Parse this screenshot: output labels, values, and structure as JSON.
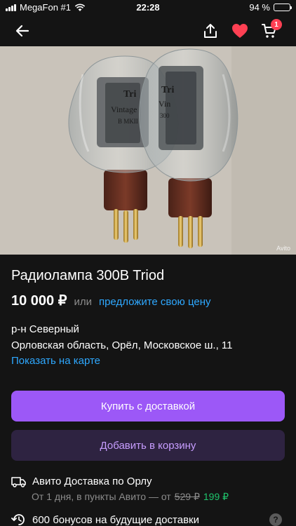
{
  "status": {
    "carrier": "MegaFon #1",
    "time": "22:28",
    "battery": "94 %",
    "battery_level": 0.94
  },
  "header": {
    "cart_count": "1",
    "icons": [
      "back-arrow-icon",
      "share-icon",
      "heart-icon",
      "cart-icon"
    ]
  },
  "photo": {
    "watermark": "Avito",
    "tube_left_label": [
      "Tri",
      "Vintage",
      "B MKII"
    ],
    "tube_right_label": [
      "Tri",
      "Vin",
      "300"
    ]
  },
  "listing": {
    "title": "Радиолампа 300B Triod",
    "price": "10 000 ₽",
    "price_or": "или",
    "price_offer": "предложите свою цену",
    "district": "р-н Северный",
    "address": "Орловская область, Орёл, Московское ш., 11",
    "map_link": "Показать на карте"
  },
  "actions": {
    "buy_label": "Купить с доставкой",
    "add_to_cart_label": "Добавить в корзину"
  },
  "delivery": {
    "title": "Авито Доставка по Орлу",
    "sub": "От 1 дня, в пункты Авито — от",
    "old_price": "529 ₽",
    "new_price": "199 ₽",
    "bonus": "600 бонусов на будущие доставки",
    "help": "?"
  },
  "colors": {
    "background": "#141414",
    "link": "#2ea8ff",
    "buy_button": "#9c58f7",
    "cart_button": "#2e2341",
    "cart_button_text": "#c79dff",
    "favorite": "#ff4053",
    "new_price": "#1fc46c"
  }
}
